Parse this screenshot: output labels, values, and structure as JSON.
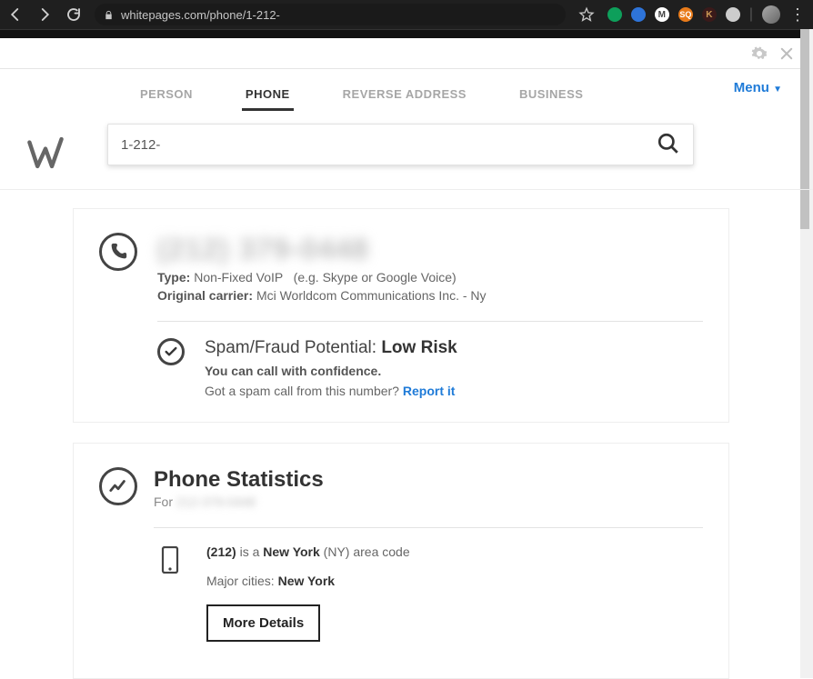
{
  "browser": {
    "url": "whitepages.com/phone/1-212-"
  },
  "menu_label": "Menu",
  "tabs": {
    "person": "PERSON",
    "phone": "PHONE",
    "reverse_address": "REVERSE ADDRESS",
    "business": "BUSINESS"
  },
  "search": {
    "value": "1-212-"
  },
  "phone_result": {
    "number_blurred": "(212) 379-0448",
    "type_label": "Type:",
    "type_value": "Non-Fixed VoIP",
    "type_example": "(e.g. Skype or Google Voice)",
    "carrier_label": "Original carrier:",
    "carrier_value": "Mci Worldcom Communications Inc. - Ny"
  },
  "spam": {
    "title_prefix": "Spam/Fraud Potential: ",
    "risk": "Low Risk",
    "confidence": "You can call with confidence.",
    "question": "Got a spam call from this number? ",
    "report": "Report it"
  },
  "stats": {
    "title": "Phone Statistics",
    "for_label": "For ",
    "for_value_blurred": "212-379-0448",
    "area_code_bold": "(212)",
    "area_mid": " is a ",
    "area_region_bold": "New York",
    "area_suffix": " (NY) area code",
    "cities_label": "Major cities: ",
    "cities_value": "New York",
    "more_details": "More Details"
  }
}
